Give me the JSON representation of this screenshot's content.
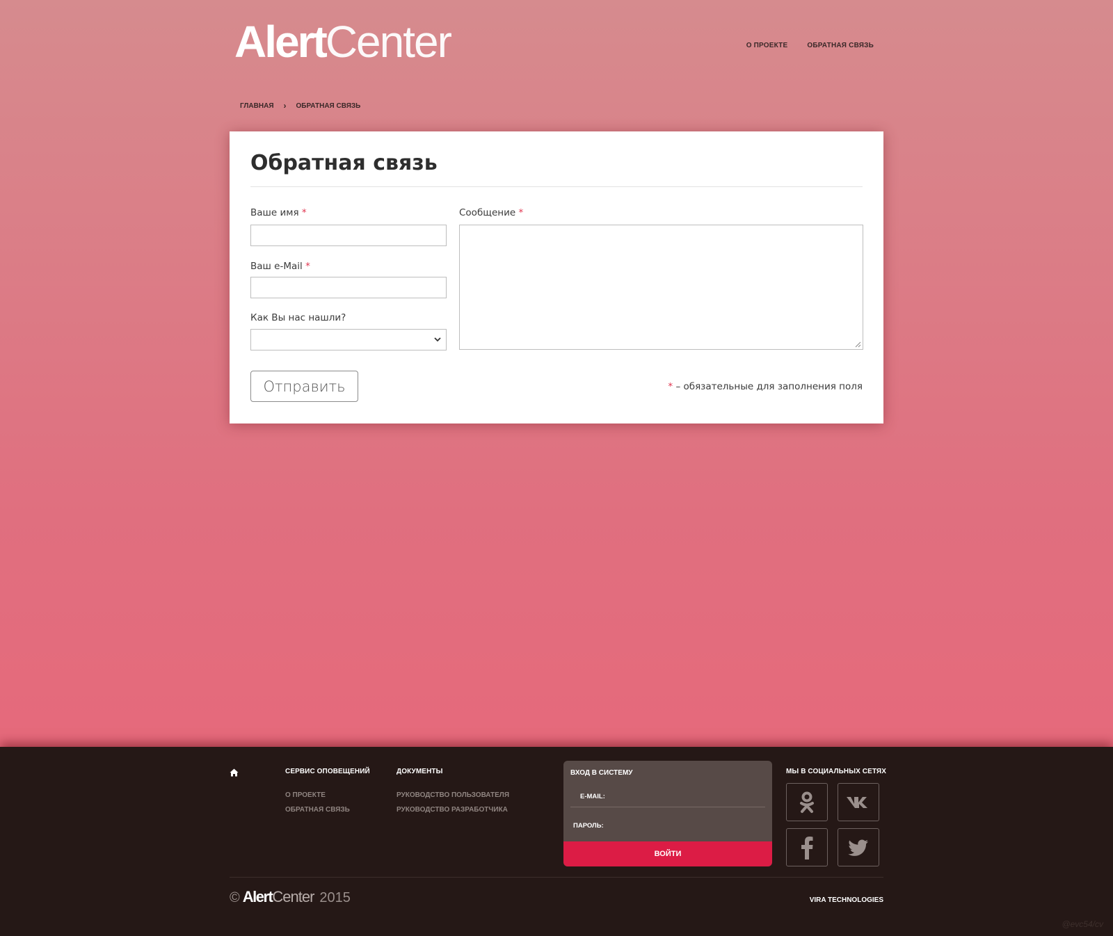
{
  "logo": {
    "bold": "Alert",
    "light": "Center"
  },
  "topnav": [
    "О ПРОЕКТЕ",
    "ОБРАТНАЯ СВЯЗЬ"
  ],
  "breadcrumb": {
    "home": "ГЛАВНАЯ",
    "separator": "›",
    "current": "ОБРАТНАЯ СВЯЗЬ"
  },
  "form": {
    "title": "Обратная связь",
    "name_label": "Ваше имя",
    "email_label": "Ваш e-Mail",
    "source_label": "Как Вы нас нашли?",
    "message_label": "Сообщение",
    "required_mark": "*",
    "name_value": "",
    "email_value": "",
    "source_value": "",
    "message_value": "",
    "submit_label": "Отправить",
    "required_note": "– обязательные для заполнения поля"
  },
  "footer": {
    "home_icon": "home-icon",
    "col1": {
      "title": "СЕРВИС ОПОВЕЩЕНИЙ",
      "links": [
        "О ПРОЕКТЕ",
        "ОБРАТНАЯ СВЯЗЬ"
      ]
    },
    "col2": {
      "title": "ДОКУМЕНТЫ",
      "links": [
        "РУКОВОДСТВО ПОЛЬЗОВАТЕЛЯ",
        "РУКОВОДСТВО РАЗРАБОТЧИКА"
      ]
    },
    "login": {
      "title": "ВХОД В СИСТЕМУ",
      "email_label": "E-MAIL:",
      "password_label": "ПАРОЛЬ:",
      "button": "ВОЙТИ"
    },
    "social": {
      "title": "МЫ В СОЦИАЛЬНЫХ СЕТЯХ",
      "icons": [
        "odnoklassniki-icon",
        "vk-icon",
        "facebook-icon",
        "twitter-icon"
      ]
    },
    "copyright": {
      "symbol": "©",
      "bold": "Alert",
      "light": "Center",
      "year": "2015"
    },
    "company": "VIRA TECHNOLOGIES",
    "watermark": "@evc54/cv"
  },
  "colors": {
    "accent": "#dc1c45",
    "footer_bg": "#251816",
    "required": "#e0354f"
  }
}
